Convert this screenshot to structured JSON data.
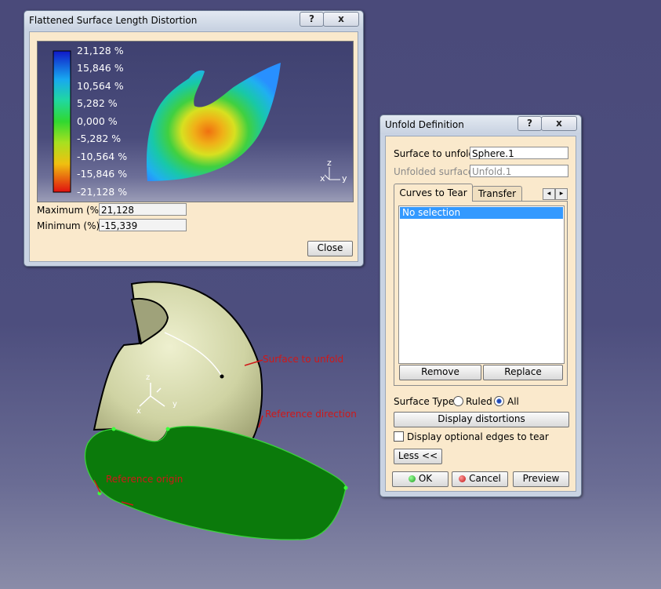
{
  "distortion": {
    "title": "Flattened Surface Length Distortion",
    "help_button": "?",
    "close_x": "x",
    "legend": [
      "21,128 %",
      "15,846 %",
      "10,564 %",
      "5,282 %",
      "0,000 %",
      "-5,282 %",
      "-10,564 %",
      "-15,846 %",
      "-21,128 %"
    ],
    "axis_z": "z",
    "axis_x": "x",
    "axis_y": "y",
    "maximum_label": "Maximum (%):",
    "maximum_value": "21,128",
    "minimum_label": "Minimum (%):",
    "minimum_value": "-15,339",
    "close_button": "Close"
  },
  "unfold": {
    "title": "Unfold Definition",
    "help_button": "?",
    "close_x": "x",
    "surface_to_unfold_label": "Surface to unfold:",
    "surface_to_unfold_value": "Sphere.1",
    "unfolded_surface_label": "Unfolded surface:",
    "unfolded_surface_value": "Unfold.1",
    "tabs": [
      "Curves to Tear",
      "Transfer"
    ],
    "tab_left": "◂",
    "tab_right": "▸",
    "list_items": [
      "No selection"
    ],
    "remove_button": "Remove",
    "replace_button": "Replace",
    "surface_type_label": "Surface Type:",
    "ruled_label": "Ruled",
    "all_label": "All",
    "display_distortions_button": "Display distortions",
    "optional_edges_label": "Display optional edges to tear",
    "less_button": "Less <<",
    "ok_button": "OK",
    "cancel_button": "Cancel",
    "preview_button": "Preview"
  },
  "viewport": {
    "annotation_surface": "Surface to unfold",
    "annotation_direction": "Reference direction",
    "annotation_origin": "Reference origin",
    "axis_x": "x",
    "axis_y": "y",
    "axis_z": "z"
  },
  "colors": {
    "unfolded_fill": "#0b7a0b",
    "sphere_fill": "#cfd3a4",
    "annotation": "#d01818"
  }
}
